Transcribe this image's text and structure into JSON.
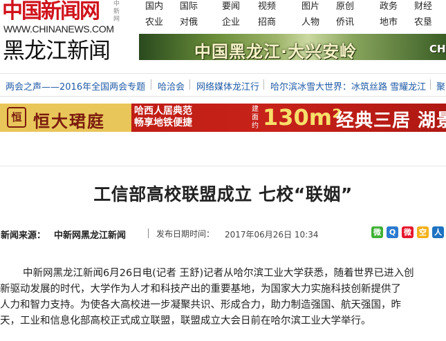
{
  "logo": {
    "top_text": "中国新闻网",
    "small_text": "中新网",
    "url": "WWW.CHINANEWS.COM",
    "region": "黑龙江新闻"
  },
  "topnav": {
    "items": [
      "国内",
      "国际",
      "要闻",
      "视频",
      "图片",
      "原创",
      "政务",
      "财经",
      "农业",
      "对俄",
      "企业",
      "招商",
      "人物",
      "侨讯",
      "地市",
      "农垦"
    ]
  },
  "banner1": {
    "text": "中国黑龙江·大兴安岭",
    "tail": "CH"
  },
  "channel": {
    "items": [
      "两会之声——2016年全国两会专题",
      "哈洽会",
      "网络媒体龙江行",
      "哈尔滨冰雪大世界：冰筑丝路 雪耀龙江",
      "聚"
    ]
  },
  "ad": {
    "brand": "恒大珺庭",
    "brand_mark": "恒",
    "slogan_line1": "哈西人居典范",
    "slogan_line2": "畅享地铁便捷",
    "area_prefix": "建面约",
    "area_value": "130m²",
    "tag": "经典三居 湖景美"
  },
  "article": {
    "title": "工信部高校联盟成立 七校“联姻”",
    "source_label": "新闻来源：",
    "source": "中新网黑龙江新闻",
    "date_label": "发布日期时间：",
    "date": "2017年06月26日 10:34",
    "paragraphs": [
      "中新网黑龙江新闻6月26日电(记者 王舒)记者从哈尔滨工业大学获悉，随着世界已进入创",
      "新驱动发展的时代，大学作为人才和科技产出的重要基地，为国家大力实施科技创新提供了",
      "人力和智力支持。为使各大高校进一步凝聚共识、形成合力，助力制造强国、航天强国，昨",
      "天，工业和信息化部高校正式成立联盟，联盟成立大会日前在哈尔滨工业大学举行。"
    ]
  },
  "share": {
    "icons": [
      "wechat-icon",
      "qq-icon",
      "weibo-icon",
      "qzone-icon",
      "renren-icon"
    ],
    "glyphs": [
      "微",
      "Q",
      "微",
      "空",
      "人"
    ]
  },
  "colors": {
    "brand_red": "#d0121b",
    "link_blue": "#1f5aa5"
  }
}
